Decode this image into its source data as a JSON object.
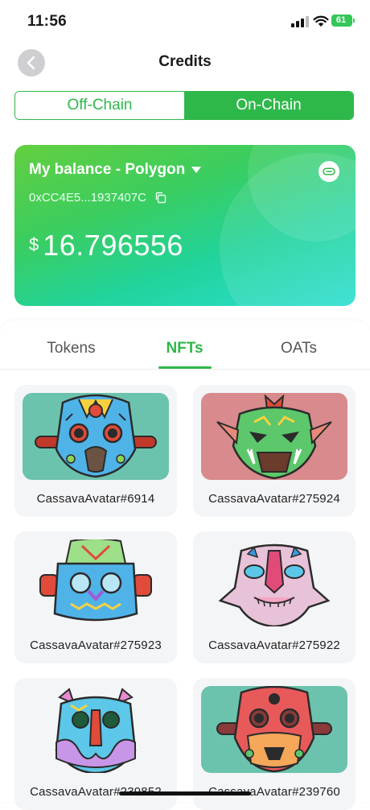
{
  "status_bar": {
    "time": "11:56",
    "battery": "61"
  },
  "header": {
    "title": "Credits"
  },
  "segmented_control": {
    "options": [
      "Off-Chain",
      "On-Chain"
    ],
    "selected": "On-Chain"
  },
  "balance_card": {
    "label": "My balance - Polygon",
    "address": "0xCC4E5...1937407C",
    "currency_symbol": "$",
    "amount": "16.796556"
  },
  "asset_tabs": {
    "items": [
      "Tokens",
      "NFTs",
      "OATs"
    ],
    "selected": "NFTs"
  },
  "nfts": [
    {
      "name": "CassavaAvatar#6914",
      "bg": "#6cc3ad"
    },
    {
      "name": "CassavaAvatar#275924",
      "bg": "#d98a8c"
    },
    {
      "name": "CassavaAvatar#275923",
      "bg": "#f4f5f7"
    },
    {
      "name": "CassavaAvatar#275922",
      "bg": "#f4f5f7"
    },
    {
      "name": "CassavaAvatar#239852",
      "bg": "#f4f5f7"
    },
    {
      "name": "CassavaAvatar#239760",
      "bg": "#6cc3ad"
    }
  ],
  "colors": {
    "accent": "#2fb84a",
    "card_gradient_start": "#64cf3f",
    "card_gradient_end": "#2ddfd1"
  }
}
